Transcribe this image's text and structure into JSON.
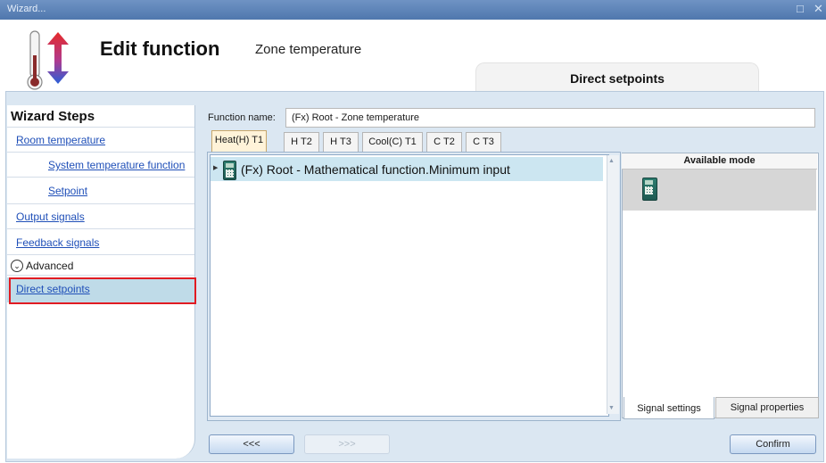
{
  "window": {
    "title": "Wizard...",
    "controls": {
      "restore": "□",
      "close": "✕"
    }
  },
  "header": {
    "title": "Edit function",
    "subtitle": "Zone temperature",
    "panel_label": "Direct setpoints"
  },
  "steps": {
    "title": "Wizard Steps",
    "items": [
      "Room temperature",
      "System temperature function",
      "Setpoint",
      "Output signals",
      "Feedback signals"
    ],
    "advanced_label": "Advanced",
    "advanced_icon": "⌄",
    "active_item": "Direct setpoints"
  },
  "function": {
    "name_label": "Function name:",
    "name_value": "(Fx) Root - Zone temperature"
  },
  "tabs": [
    "Heat(H) T1",
    "H T2",
    "H T3",
    "Cool(C) T1",
    "C T2",
    "C T3"
  ],
  "list": {
    "items": [
      "(Fx) Root - Mathematical function.Minimum input"
    ]
  },
  "mode_panel": {
    "title": "Available mode",
    "tabs": [
      "Signal settings",
      "Signal properties"
    ]
  },
  "buttons": {
    "back": "<<<",
    "next": ">>>",
    "confirm": "Confirm"
  },
  "colors": {
    "accent": "#4f77ad",
    "highlight": "#e11b22",
    "selection": "#cce6f1"
  }
}
